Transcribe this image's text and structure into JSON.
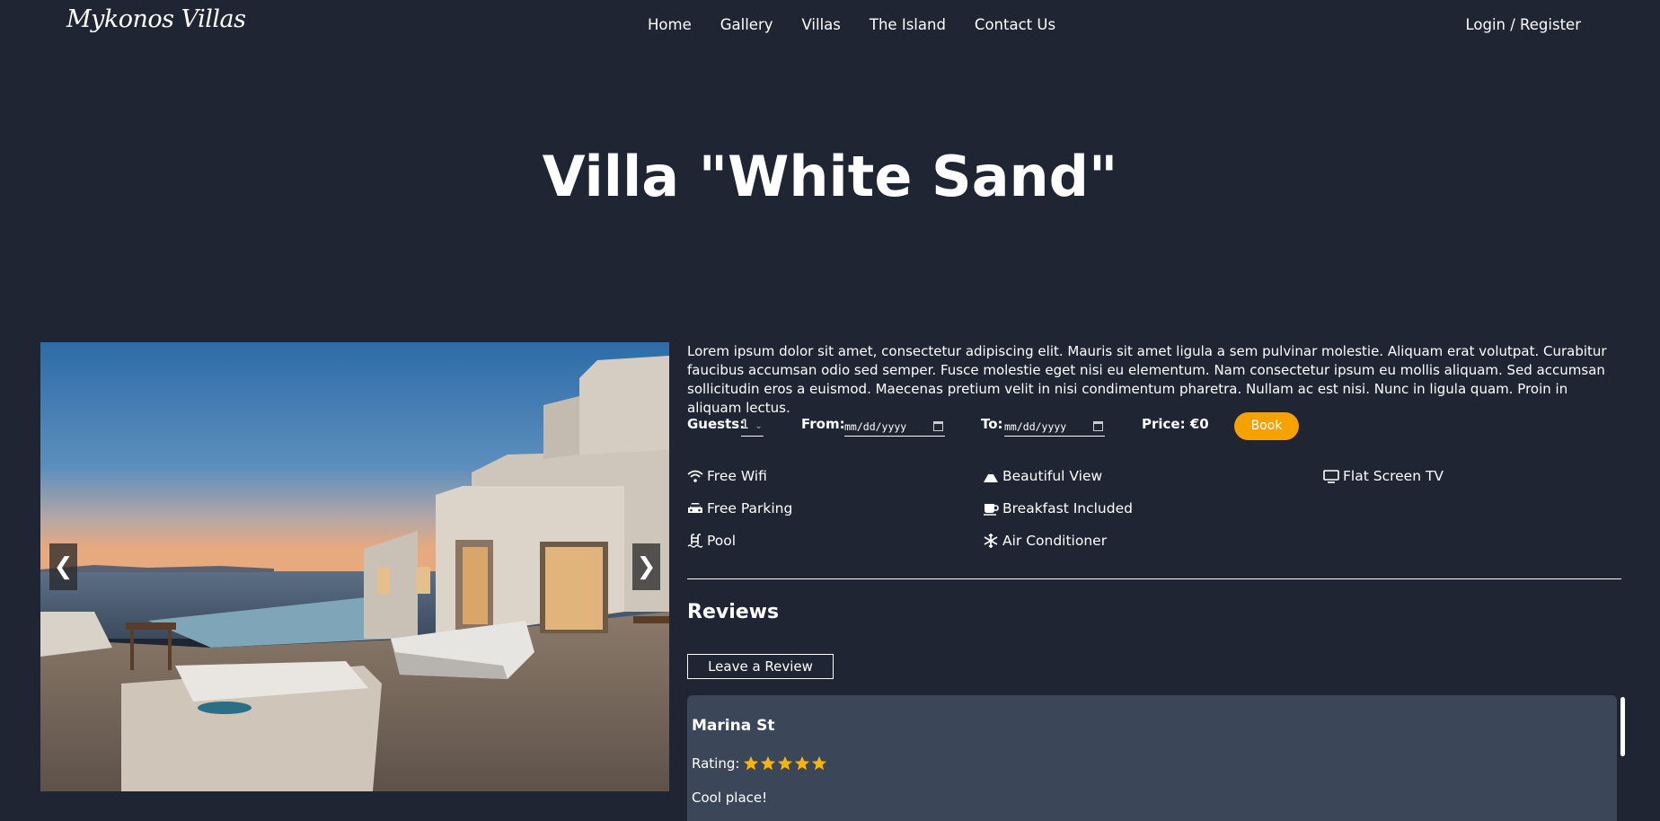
{
  "nav": {
    "logo": "Mykonos Villas",
    "links": [
      "Home",
      "Gallery",
      "Villas",
      "The Island",
      "Contact Us"
    ],
    "login": "Login / Register"
  },
  "title": "Villa \"White Sand\"",
  "carousel": {
    "prev": "❮",
    "next": "❯"
  },
  "description": "Lorem ipsum dolor sit amet, consectetur adipiscing elit. Mauris sit amet ligula a sem pulvinar molestie. Aliquam erat volutpat. Curabitur faucibus accumsan odio sed semper. Fusce molestie eget nisi eu elementum. Nam consectetur ipsum eu mollis aliquam. Sed accumsan sollicitudin eros a euismod. Maecenas pretium velit in nisi condimentum pharetra. Nullam ac est nisi. Nunc in ligula quam. Proin in aliquam lectus.",
  "booking": {
    "guests_label": "Guests:",
    "guests_value": "1",
    "from_label": "From:",
    "to_label": "To:",
    "date_placeholder": "mm/dd/yyyy",
    "price": "Price: €0",
    "book": "Book"
  },
  "amenities": [
    {
      "label": "Free Wifi",
      "icon": "wifi-icon"
    },
    {
      "label": "Beautiful View",
      "icon": "mountain-icon"
    },
    {
      "label": "Flat Screen TV",
      "icon": "tv-icon"
    },
    {
      "label": "Free Parking",
      "icon": "car-icon"
    },
    {
      "label": "Breakfast Included",
      "icon": "coffee-icon"
    },
    {
      "label": "Pool",
      "icon": "pool-icon"
    },
    {
      "label": "Air Conditioner",
      "icon": "snowflake-icon"
    }
  ],
  "reviews": {
    "title": "Reviews",
    "leave": "Leave a Review",
    "items": [
      {
        "name": "Marina St",
        "rating_label": "Rating:",
        "rating": 5,
        "comment": "Cool place!"
      }
    ]
  },
  "colors": {
    "background": "#1f2532",
    "accent": "#f5a100",
    "review_bg": "#3b4759",
    "star": "#f5b50a"
  }
}
